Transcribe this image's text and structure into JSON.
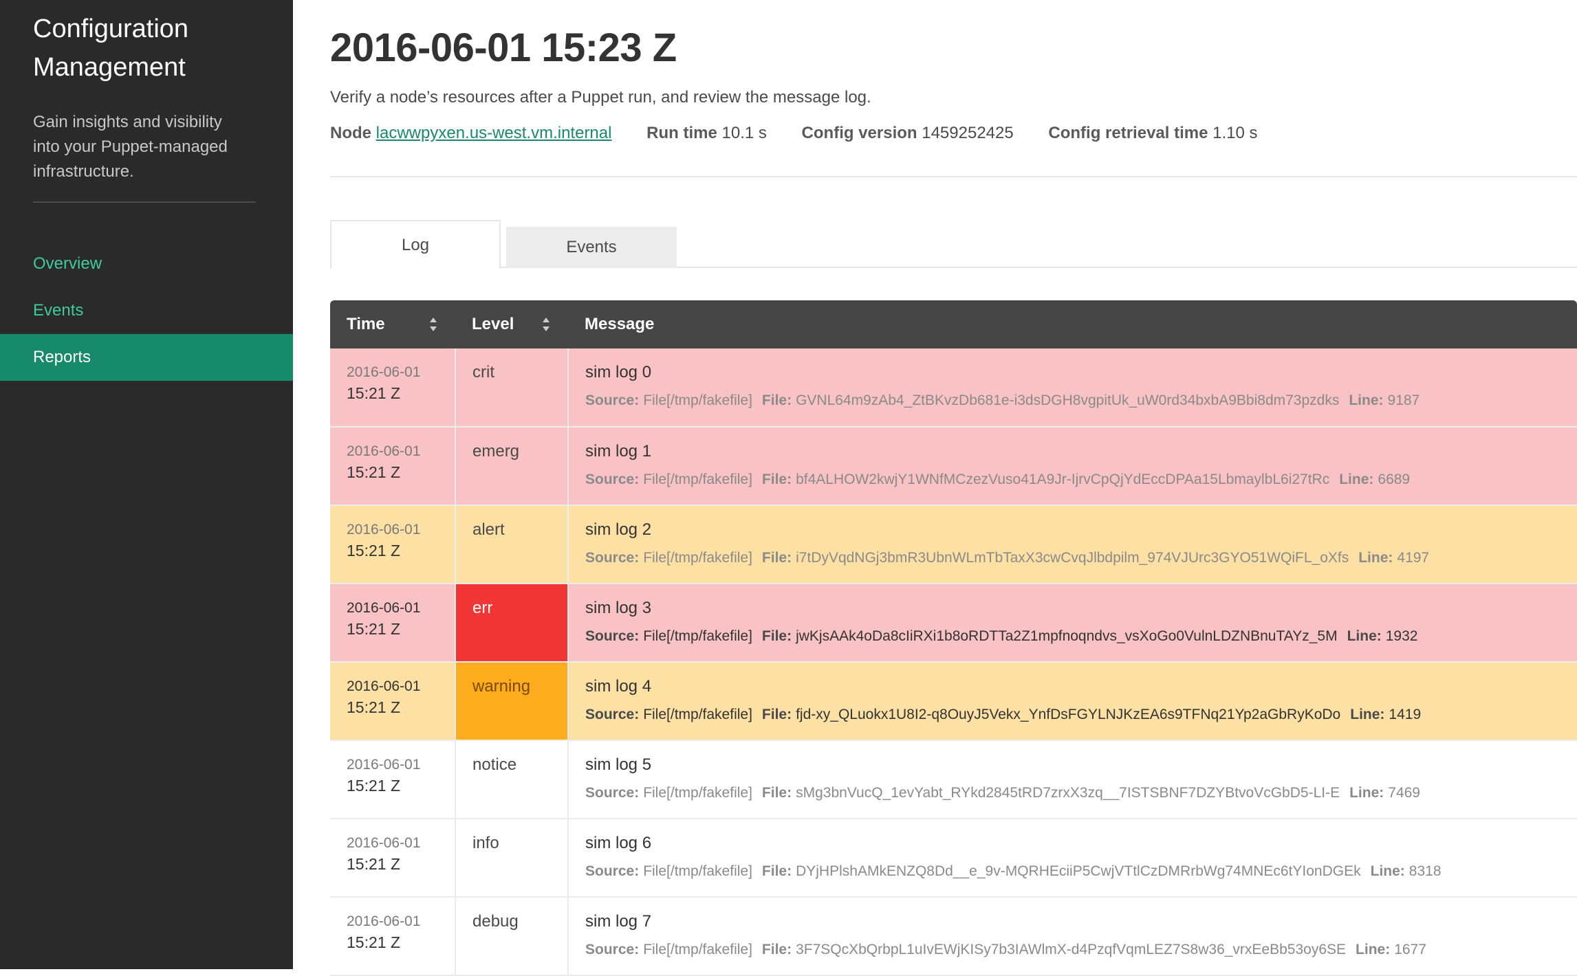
{
  "sidebar": {
    "title": "Configuration Management",
    "description": "Gain insights and visibility into your Puppet-managed infrastructure.",
    "nav": [
      {
        "label": "Overview"
      },
      {
        "label": "Events"
      },
      {
        "label": "Reports"
      }
    ],
    "active_item": "Reports"
  },
  "header": {
    "title": "2016-06-01 15:23 Z",
    "subtitle": "Verify a node’s resources after a Puppet run, and review the message log.",
    "node_label": "Node",
    "node_value": "lacwwpyxen.us-west.vm.internal",
    "run_time_label": "Run time",
    "run_time_value": "10.1 s",
    "config_version_label": "Config version",
    "config_version_value": "1459252425",
    "config_retrieval_label": "Config retrieval time",
    "config_retrieval_value": "1.10 s"
  },
  "tabs": [
    {
      "label": "Log",
      "active": true
    },
    {
      "label": "Events",
      "active": false
    }
  ],
  "table": {
    "columns": [
      "Time",
      "Level",
      "Message"
    ],
    "source_key": "Source:",
    "file_key": "File:",
    "line_key": "Line:",
    "rows": [
      {
        "date": "2016-06-01",
        "time": "15:21 Z",
        "level": "crit",
        "message": "sim log 0",
        "source": "File[/tmp/fakefile]",
        "file": "GVNL64m9zAb4_ZtBKvzDb681e-i3dsDGH8vgpitUk_uW0rd34bxbA9Bbi8dm73pzdks",
        "line": "9187"
      },
      {
        "date": "2016-06-01",
        "time": "15:21 Z",
        "level": "emerg",
        "message": "sim log 1",
        "source": "File[/tmp/fakefile]",
        "file": "bf4ALHOW2kwjY1WNfMCzezVuso41A9Jr-IjrvCpQjYdEccDPAa15LbmaylbL6i27tRc",
        "line": "6689"
      },
      {
        "date": "2016-06-01",
        "time": "15:21 Z",
        "level": "alert",
        "message": "sim log 2",
        "source": "File[/tmp/fakefile]",
        "file": "i7tDyVqdNGj3bmR3UbnWLmTbTaxX3cwCvqJlbdpilm_974VJUrc3GYO51WQiFL_oXfs",
        "line": "4197"
      },
      {
        "date": "2016-06-01",
        "time": "15:21 Z",
        "level": "err",
        "message": "sim log 3",
        "source": "File[/tmp/fakefile]",
        "file": "jwKjsAAk4oDa8cIiRXi1b8oRDTTa2Z1mpfnoqndvs_vsXoGo0VulnLDZNBnuTAYz_5M",
        "line": "1932"
      },
      {
        "date": "2016-06-01",
        "time": "15:21 Z",
        "level": "warning",
        "message": "sim log 4",
        "source": "File[/tmp/fakefile]",
        "file": "fjd-xy_QLuokx1U8I2-q8OuyJ5Vekx_YnfDsFGYLNJKzEA6s9TFNq21Yp2aGbRyKoDo",
        "line": "1419"
      },
      {
        "date": "2016-06-01",
        "time": "15:21 Z",
        "level": "notice",
        "message": "sim log 5",
        "source": "File[/tmp/fakefile]",
        "file": "sMg3bnVucQ_1evYabt_RYkd2845tRD7zrxX3zq__7ISTSBNF7DZYBtvoVcGbD5-LI-E",
        "line": "7469"
      },
      {
        "date": "2016-06-01",
        "time": "15:21 Z",
        "level": "info",
        "message": "sim log 6",
        "source": "File[/tmp/fakefile]",
        "file": "DYjHPlshAMkENZQ8Dd__e_9v-MQRHEciiP5CwjVTtlCzDMRrbWg74MNEc6tYIonDGEk",
        "line": "8318"
      },
      {
        "date": "2016-06-01",
        "time": "15:21 Z",
        "level": "debug",
        "message": "sim log 7",
        "source": "File[/tmp/fakefile]",
        "file": "3F7SQcXbQrbpL1uIvEWjKISy7b3IAWlmX-d4PzqfVqmLEZ7S8w36_vrxEeBb53oy6SE",
        "line": "1677"
      }
    ]
  },
  "colors": {
    "sidebar_bg": "#2a2a2a",
    "accent": "#178a6a",
    "nav_link": "#3ecb9e",
    "row_pink": "#f9c2c4",
    "row_yellow": "#fde0a3",
    "err_badge": "#f23535",
    "warning_badge": "#fcac1c"
  }
}
